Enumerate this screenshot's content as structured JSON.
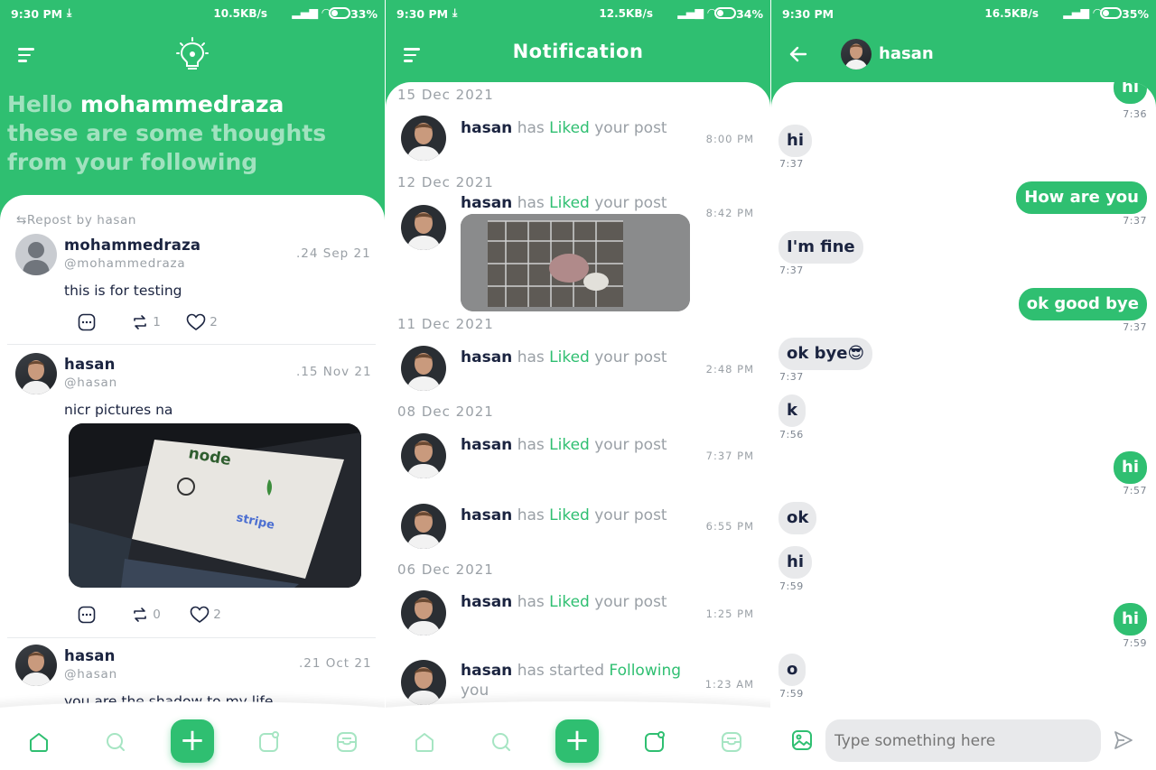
{
  "colors": {
    "accent": "#2fbf71",
    "text": "#1b2440",
    "muted": "#9aa0a6",
    "bubble_in": "#e8e9eb"
  },
  "screens": [
    {
      "status": {
        "time": "9:30 PM",
        "speed": "10.5KB/s",
        "battery": "33%"
      },
      "greeting": {
        "hello": "Hello",
        "user": "mohammedraza",
        "subtitle": "these are some thoughts from your following"
      },
      "posts": [
        {
          "repost_label": "Repost by hasan",
          "name": "mohammedraza",
          "handle": "@mohammedraza",
          "date": ".24 Sep 21",
          "text": "this is for testing",
          "reposts": "1",
          "likes": "2"
        },
        {
          "name": "hasan",
          "handle": "@hasan",
          "date": ".15 Nov 21",
          "text": "nicr pictures na",
          "image_text": "node",
          "image_text2": "stripe",
          "reposts": "0",
          "likes": "2"
        },
        {
          "name": "hasan",
          "handle": "@hasan",
          "date": ".21 Oct 21",
          "text": "you are the shadow to my life"
        }
      ],
      "nav": [
        "home-icon",
        "search-icon",
        "add-icon",
        "post-icon",
        "inbox-icon"
      ]
    },
    {
      "status": {
        "time": "9:30 PM",
        "speed": "12.5KB/s",
        "battery": "34%"
      },
      "title": "Notification",
      "groups": [
        {
          "date": "15 Dec 2021"
        },
        {
          "date": "12 Dec 2021"
        },
        {
          "date": "11 Dec 2021"
        },
        {
          "date": "08 Dec 2021"
        },
        {
          "date": "06 Dec 2021"
        }
      ],
      "items": [
        {
          "user": "hasan",
          "has": "has",
          "action": "Liked",
          "rest": "your post",
          "time": "8:00 PM"
        },
        {
          "user": "hasan",
          "has": "has",
          "action": "Liked",
          "rest": "your post",
          "time": "8:42 PM"
        },
        {
          "user": "hasan",
          "has": "has",
          "action": "Liked",
          "rest": "your post",
          "time": "2:48 PM"
        },
        {
          "user": "hasan",
          "has": "has",
          "action": "Liked",
          "rest": "your post",
          "time": "7:37 PM"
        },
        {
          "user": "hasan",
          "has": "has",
          "action": "Liked",
          "rest": "your post",
          "time": "6:55 PM"
        },
        {
          "user": "hasan",
          "has": "has",
          "action": "Liked",
          "rest": "your post",
          "time": "1:25 PM"
        },
        {
          "user": "hasan",
          "has": "has started",
          "action": "Following",
          "rest": "you",
          "time": "1:23 AM"
        }
      ]
    },
    {
      "status": {
        "time": "9:30 PM",
        "speed": "16.5KB/s",
        "battery": "35%"
      },
      "contact": "hasan",
      "messages": [
        {
          "dir": "out",
          "text": "hi",
          "time": "7:36"
        },
        {
          "dir": "in",
          "text": "hi",
          "time": "7:37"
        },
        {
          "dir": "out",
          "text": "How are you",
          "time": "7:37"
        },
        {
          "dir": "in",
          "text": "I'm fine",
          "time": "7:37"
        },
        {
          "dir": "out",
          "text": "ok good bye",
          "time": "7:37"
        },
        {
          "dir": "in",
          "text": "ok bye😎",
          "time": "7:37"
        },
        {
          "dir": "in",
          "text": "k",
          "time": "7:56"
        },
        {
          "dir": "out",
          "text": "hi",
          "time": "7:57"
        },
        {
          "dir": "in",
          "text": "ok",
          "time": ""
        },
        {
          "dir": "in",
          "text": "hi",
          "time": "7:59"
        },
        {
          "dir": "out",
          "text": "hi",
          "time": "7:59"
        },
        {
          "dir": "in",
          "text": "o",
          "time": "7:59"
        }
      ],
      "input_placeholder": "Type something here"
    }
  ]
}
